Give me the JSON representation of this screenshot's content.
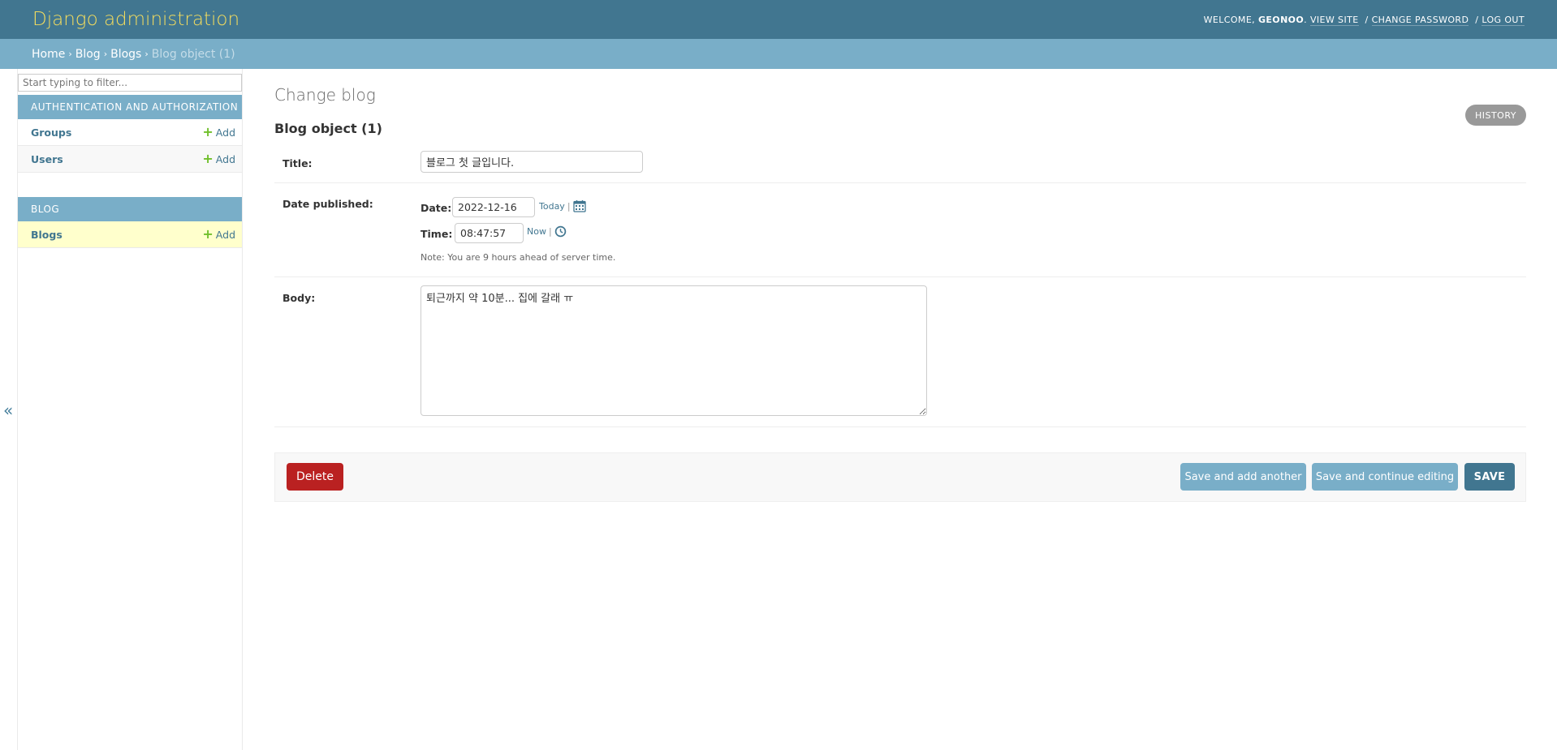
{
  "header": {
    "brand": "Django administration",
    "welcome": "WELCOME, ",
    "username": "GEONOO",
    "view_site": "VIEW SITE",
    "change_password": "CHANGE PASSWORD",
    "log_out": "LOG OUT",
    "separator": "/"
  },
  "breadcrumbs": {
    "items": [
      "Home",
      "Blog",
      "Blogs"
    ],
    "current": "Blog object (1)",
    "separator": "›"
  },
  "sidebar": {
    "filter_placeholder": "Start typing to filter...",
    "modules": [
      {
        "caption": "AUTHENTICATION AND AUTHORIZATION",
        "models": [
          {
            "name": "Groups",
            "add": "Add"
          },
          {
            "name": "Users",
            "add": "Add"
          }
        ]
      },
      {
        "caption": "BLOG",
        "models": [
          {
            "name": "Blogs",
            "add": "Add"
          }
        ]
      }
    ],
    "toggle": "«"
  },
  "main": {
    "title": "Change blog",
    "history_label": "HISTORY",
    "object_title": "Blog object (1)",
    "fields": {
      "title": {
        "label": "Title:",
        "value": "블로그 첫 글입니다."
      },
      "date_published": {
        "label": "Date published:",
        "date_label": "Date:",
        "date_value": "2022-12-16",
        "today": "Today",
        "time_label": "Time:",
        "time_value": "08:47:57",
        "now": "Now",
        "bar": "|",
        "note": "Note: You are 9 hours ahead of server time."
      },
      "body": {
        "label": "Body:",
        "value": "퇴근까지 약 10분... 집에 갈래 ㅠ"
      }
    },
    "buttons": {
      "delete": "Delete",
      "save_add_another": "Save and add another",
      "save_continue": "Save and continue editing",
      "save": "SAVE"
    }
  },
  "colors": {
    "header": "#417690",
    "brand": "#f5dd5d",
    "breadcrumbs": "#79aec8",
    "delete": "#ba2121",
    "primary": "#417690",
    "secondary": "#79aec8",
    "current_row": "#ffffcc",
    "add_icon": "#70bf2b"
  }
}
